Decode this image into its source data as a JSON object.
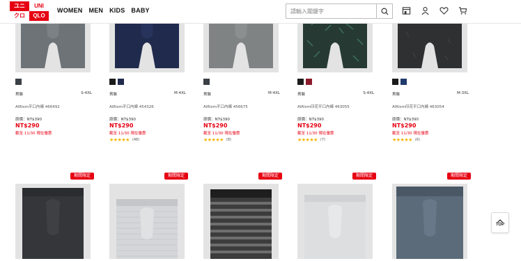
{
  "header": {
    "logo": [
      "ユニ",
      "UNI",
      "クロ",
      "QLO"
    ],
    "nav": [
      "WOMEN",
      "MEN",
      "KIDS",
      "BABY"
    ],
    "search_placeholder": "請輸入關鍵字",
    "icons": [
      "search-icon",
      "store-icon",
      "user-icon",
      "heart-icon",
      "cart-icon"
    ]
  },
  "row1": [
    {
      "garment": "#6d7377",
      "waistband": "#5d6367",
      "swatches": [
        "#3a4046"
      ],
      "gender": "男裝",
      "size": "S-4XL",
      "name": "AIRism平口內褲 466492",
      "orig_price": "原價：NT$390",
      "price": "NT$290",
      "promo": "截至 11/30 現在優惠",
      "stars": "",
      "count": ""
    },
    {
      "garment": "#1f2a4d",
      "waistband": "#1a2342",
      "swatches": [
        "#1b1b1b",
        "#1f2a4d"
      ],
      "gender": "男裝",
      "size": "M-4XL",
      "name": "AIRism平口內褲 454326",
      "orig_price": "原價：NT$390",
      "price": "NT$290",
      "promo": "截至 11/30 現在優惠",
      "stars": "★★★★★",
      "count": "(48)"
    },
    {
      "garment": "#808384",
      "waistband": "#6f7273",
      "swatches": [
        "#3a4046"
      ],
      "gender": "男裝",
      "size": "M-4XL",
      "name": "AIRism平口內褲 456675",
      "orig_price": "原價：NT$390",
      "price": "NT$290",
      "promo": "截至 11/30 現在優惠",
      "stars": "★★★★★",
      "count": "(8)"
    },
    {
      "garment": "#263a33",
      "waistband": "#233029",
      "swatches": [
        "#1b1b1b",
        "#8b1a2b"
      ],
      "gender": "男裝",
      "size": "S-4XL",
      "name": "AIRism印花平口內褲 463055",
      "orig_price": "原價：NT$390",
      "price": "NT$290",
      "promo": "截至 11/30 現在優惠",
      "stars": "★★★★★",
      "count": "(7)"
    },
    {
      "garment": "#2f3032",
      "waistband": "#262729",
      "swatches": [
        "#1b1b1b",
        "#1f3a6b"
      ],
      "gender": "男裝",
      "size": "M-3XL",
      "name": "AIRism印花平口內褲 463054",
      "orig_price": "原價：NT$390",
      "price": "NT$290",
      "promo": "截至 11/30 現在優惠",
      "stars": "★★★★★",
      "count": "(6)"
    }
  ],
  "row2": [
    {
      "badge": "期間限定",
      "garment": "#34363a",
      "waistband": "#2a2c30"
    },
    {
      "badge": "期間限定",
      "garment": "#d4d6d9",
      "waistband": "#c4c6c9"
    },
    {
      "badge": "期間限定",
      "garment": "#3c3c3c",
      "waistband": "#1e1e1e"
    },
    {
      "badge": "期間限定",
      "garment": "#dcdee0",
      "waistband": "#cfd1d3"
    },
    {
      "badge": "期間限定",
      "garment": "#5b6b7a",
      "waistband": "#4a5866"
    }
  ],
  "top_button": "TOP"
}
